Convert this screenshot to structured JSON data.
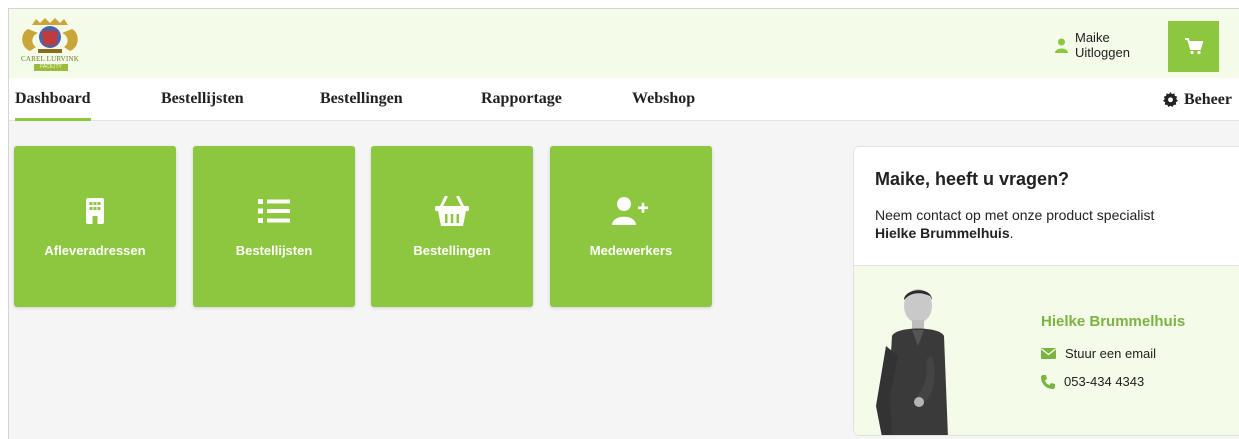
{
  "header": {
    "logo_text": "CAREL LURVINK",
    "logo_badge": "FACILITY",
    "user_name": "Maike",
    "logout_label": "Uitloggen"
  },
  "nav": {
    "items": [
      {
        "label": "Dashboard",
        "active": true
      },
      {
        "label": "Bestellijsten",
        "active": false
      },
      {
        "label": "Bestellingen",
        "active": false
      },
      {
        "label": "Rapportage",
        "active": false
      },
      {
        "label": "Webshop",
        "active": false
      }
    ],
    "beheer_label": "Beheer"
  },
  "tiles": [
    {
      "label": "Afleveradressen",
      "icon": "building-icon"
    },
    {
      "label": "Bestellijsten",
      "icon": "list-icon"
    },
    {
      "label": "Bestellingen",
      "icon": "basket-icon"
    },
    {
      "label": "Medewerkers",
      "icon": "user-plus-icon"
    }
  ],
  "contact": {
    "title": "Maike, heeft u vragen?",
    "text": "Neem contact op met onze product specialist",
    "specialist_bold": "Hielke Brummelhuis",
    "specialist_suffix": ".",
    "name": "Hielke Brummelhuis",
    "email_label": "Stuur een email",
    "phone": "053-434 4343"
  },
  "colors": {
    "accent": "#8dc63f",
    "header_bg": "#f4fbe9",
    "specialist_name": "#7cb342"
  }
}
